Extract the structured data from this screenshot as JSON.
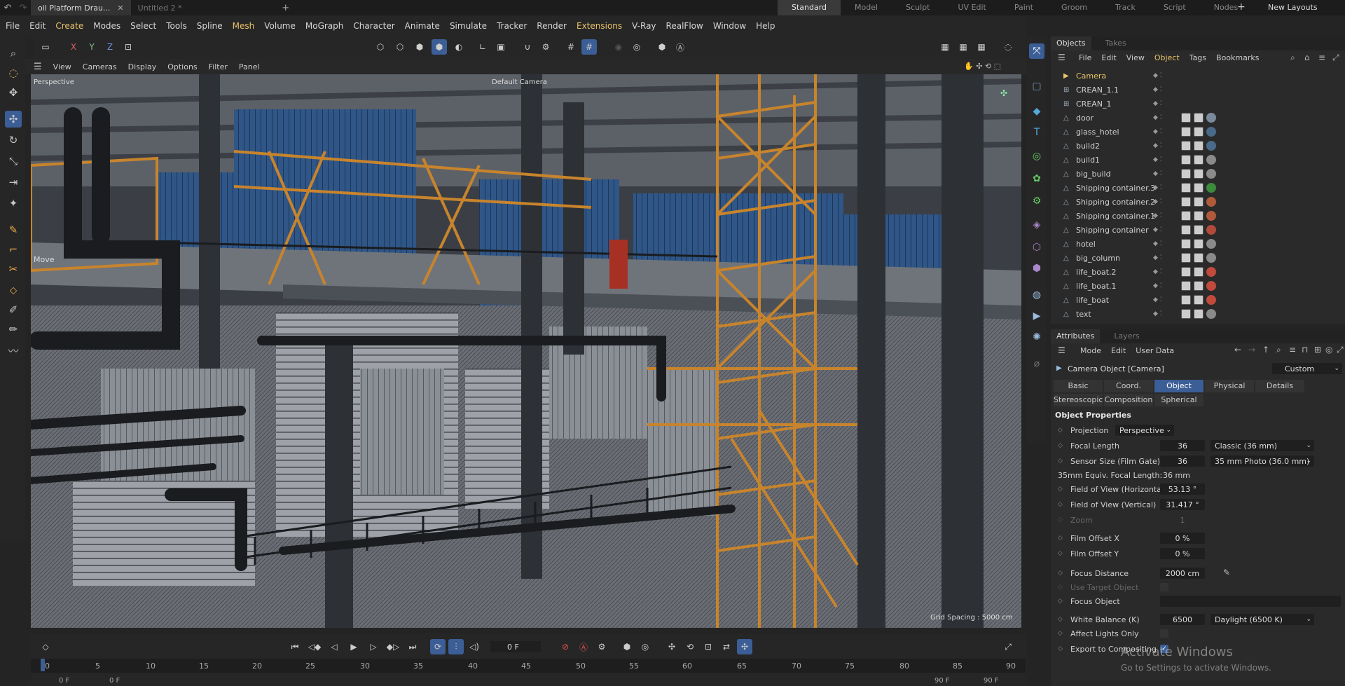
{
  "title_bar": {
    "doc_tabs": [
      {
        "label": "oil Platform Drau...",
        "active": true
      },
      {
        "label": "Untitled 2 *",
        "active": false
      }
    ],
    "layouts": [
      "Standard",
      "Model",
      "Sculpt",
      "UV Edit",
      "Paint",
      "Groom",
      "Track",
      "Script",
      "Nodes"
    ],
    "new_layouts": "New Layouts"
  },
  "menu": [
    "File",
    "Edit",
    "Create",
    "Modes",
    "Select",
    "Tools",
    "Spline",
    "Mesh",
    "Volume",
    "MoGraph",
    "Character",
    "Animate",
    "Simulate",
    "Tracker",
    "Render",
    "Extensions",
    "V-Ray",
    "RealFlow",
    "Window",
    "Help"
  ],
  "axis_buttons": [
    "X",
    "Y",
    "Z"
  ],
  "viewport_menu": [
    "View",
    "Cameras",
    "Display",
    "Options",
    "Filter",
    "Panel"
  ],
  "viewport": {
    "projection_label": "Perspective",
    "camera_label": "Default Camera",
    "tool_label": "Move",
    "grid_spacing": "Grid Spacing : 5000 cm"
  },
  "objects_panel": {
    "tabs": [
      "Objects",
      "Takes"
    ],
    "menu": [
      "File",
      "Edit",
      "View",
      "Object",
      "Tags",
      "Bookmarks"
    ],
    "items": [
      {
        "name": "Camera",
        "tags": []
      },
      {
        "name": "CREAN_1.1",
        "tags": []
      },
      {
        "name": "CREAN_1",
        "tags": []
      },
      {
        "name": "door",
        "tags": [
          "#7a8a9a"
        ]
      },
      {
        "name": "glass_hotel",
        "tags": [
          "#4a6a8a"
        ]
      },
      {
        "name": "build2",
        "tags": [
          "#4a6a8a"
        ]
      },
      {
        "name": "build1",
        "tags": [
          "#8a8a8a"
        ]
      },
      {
        "name": "big_build",
        "tags": [
          "#8a8a8a"
        ]
      },
      {
        "name": "Shipping container.3",
        "tags": [
          "#3c8a3c"
        ]
      },
      {
        "name": "Shipping container.2",
        "tags": [
          "#b05a3c"
        ]
      },
      {
        "name": "Shipping container.1",
        "tags": [
          "#b05a3c"
        ]
      },
      {
        "name": "Shipping container",
        "tags": [
          "#b04a3c"
        ]
      },
      {
        "name": "hotel",
        "tags": [
          "#8a8a8a"
        ]
      },
      {
        "name": "big_column",
        "tags": [
          "#8a8a8a"
        ]
      },
      {
        "name": "life_boat.2",
        "tags": [
          "#c04a3c"
        ]
      },
      {
        "name": "life_boat.1",
        "tags": [
          "#c04a3c"
        ]
      },
      {
        "name": "life_boat",
        "tags": [
          "#c04a3c"
        ]
      },
      {
        "name": "text",
        "tags": [
          "#8a8a8a"
        ]
      }
    ]
  },
  "attributes_panel": {
    "tabs": [
      "Attributes",
      "Layers"
    ],
    "menu": [
      "Mode",
      "Edit",
      "User Data"
    ],
    "object_title": "Camera Object [Camera]",
    "preset": "Custom",
    "subtabs_row1": [
      "Basic",
      "Coord.",
      "Object",
      "Physical",
      "Details"
    ],
    "subtabs_row2": [
      "Stereoscopic",
      "Composition",
      "Spherical"
    ],
    "section_title": "Object Properties",
    "projection": {
      "label": "Projection",
      "value": "Perspective"
    },
    "focal_length": {
      "label": "Focal Length",
      "value": "36",
      "preset": "Classic (36 mm)"
    },
    "sensor_size": {
      "label": "Sensor Size (Film Gate)",
      "value": "36",
      "preset": "35 mm Photo (36.0 mm)"
    },
    "equiv_focal": {
      "label": "35mm Equiv. Focal Length:",
      "value": "36 mm"
    },
    "fov_h": {
      "label": "Field of View (Horizontal)",
      "value": "53.13 °"
    },
    "fov_v": {
      "label": "Field of View (Vertical)",
      "value": "31.417 °"
    },
    "zoom": {
      "label": "Zoom",
      "value": "1"
    },
    "film_offset_x": {
      "label": "Film Offset X",
      "value": "0 %"
    },
    "film_offset_y": {
      "label": "Film Offset Y",
      "value": "0 %"
    },
    "focus_distance": {
      "label": "Focus Distance",
      "value": "2000 cm"
    },
    "use_target": {
      "label": "Use Target Object"
    },
    "focus_object": {
      "label": "Focus Object"
    },
    "white_balance": {
      "label": "White Balance (K)",
      "value": "6500",
      "preset": "Daylight (6500 K)"
    },
    "affect_lights": {
      "label": "Affect Lights Only"
    },
    "export_comp": {
      "label": "Export to Compositing"
    }
  },
  "timeline": {
    "frame_field": "0 F",
    "ticks": [
      "0",
      "5",
      "10",
      "15",
      "20",
      "25",
      "30",
      "35",
      "40",
      "45",
      "50",
      "55",
      "60",
      "65",
      "70",
      "75",
      "80",
      "85",
      "90"
    ],
    "start": "0 F",
    "start2": "0 F",
    "end": "90 F",
    "end2": "90 F"
  },
  "watermark": {
    "line1": "Activate Windows",
    "line2": "Go to Settings to activate Windows."
  }
}
